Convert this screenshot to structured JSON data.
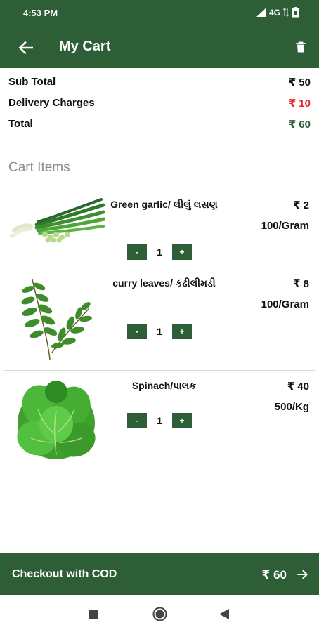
{
  "status_bar": {
    "time": "4:53 PM",
    "network": "4G"
  },
  "app_bar": {
    "title": "My Cart",
    "back_icon": "arrow-left-icon",
    "delete_icon": "trash-icon"
  },
  "summary": {
    "subtotal_label": "Sub Total",
    "subtotal_value": "₹ 50",
    "delivery_label": "Delivery Charges",
    "delivery_value": "₹ 10",
    "total_label": "Total",
    "total_value": "₹ 60",
    "colors": {
      "delivery": "#e0262b",
      "total": "#2e5e36"
    }
  },
  "cart": {
    "section_title": "Cart Items",
    "items": [
      {
        "name": "Green garlic/ લીલું લસણ",
        "price": "₹ 2",
        "unit": "100/Gram",
        "qty": "1",
        "minus": "-",
        "plus": "+"
      },
      {
        "name": "curry leaves/ કઢીલીમડી",
        "price": "₹ 8",
        "unit": "100/Gram",
        "qty": "1",
        "minus": "-",
        "plus": "+"
      },
      {
        "name": "Spinach/પાલક",
        "price": "₹ 40",
        "unit": "500/Kg",
        "qty": "1",
        "minus": "-",
        "plus": "+"
      }
    ]
  },
  "checkout": {
    "label": "Checkout with COD",
    "amount": "₹ 60"
  },
  "colors": {
    "primary": "#2e5e36"
  }
}
